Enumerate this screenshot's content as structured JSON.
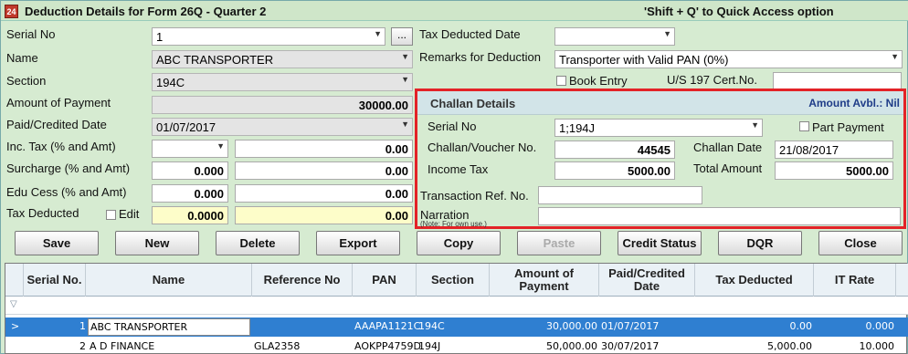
{
  "window": {
    "icon_label": "24",
    "title": "Deduction Details for Form 26Q - Quarter 2",
    "hint": "'Shift + Q' to Quick Access option"
  },
  "left": {
    "serial_no": {
      "label": "Serial No",
      "value": "1",
      "button": "..."
    },
    "name": {
      "label": "Name",
      "value": "ABC TRANSPORTER"
    },
    "section": {
      "label": "Section",
      "value": "194C"
    },
    "amount_of_payment": {
      "label": "Amount of Payment",
      "value": "30000.00"
    },
    "paid_credited_date": {
      "label": "Paid/Credited Date",
      "value": "01/07/2017"
    },
    "inc_tax": {
      "label": "Inc. Tax (% and Amt)",
      "pct": "",
      "amt": "0.00"
    },
    "surcharge": {
      "label": "Surcharge (% and Amt)",
      "pct": "0.000",
      "amt": "0.00"
    },
    "edu_cess": {
      "label": "Edu Cess (% and Amt)",
      "pct": "0.000",
      "amt": "0.00"
    },
    "tax_deducted": {
      "label": "Tax Deducted",
      "edit_label": "Edit",
      "pct": "0.0000",
      "amt": "0.00"
    }
  },
  "right": {
    "tax_deducted_date": {
      "label": "Tax Deducted Date",
      "value": ""
    },
    "remarks": {
      "label": "Remarks for Deduction",
      "value": "Transporter with Valid PAN (0%)"
    },
    "book_entry": {
      "label": "Book Entry"
    },
    "us197": {
      "label": "U/S 197 Cert.No.",
      "value": ""
    }
  },
  "challan": {
    "title": "Challan Details",
    "amount_avbl": "Amount Avbl.: Nil",
    "serial_no": {
      "label": "Serial No",
      "value": "1;194J"
    },
    "part_payment": {
      "label": "Part Payment"
    },
    "voucher": {
      "label": "Challan/Voucher No.",
      "value": "44545"
    },
    "challan_date": {
      "label": "Challan Date",
      "value": "21/08/2017"
    },
    "income_tax": {
      "label": "Income Tax",
      "value": "5000.00"
    },
    "total_amount": {
      "label": "Total Amount",
      "value": "5000.00"
    },
    "transaction_ref": {
      "label": "Transaction Ref. No.",
      "value": ""
    },
    "narration": {
      "label": "Narration",
      "note": "(Note: For own use.)",
      "value": ""
    }
  },
  "buttons": {
    "save": "Save",
    "new": "New",
    "delete": "Delete",
    "export": "Export",
    "copy": "Copy",
    "paste": "Paste",
    "credit_status": "Credit Status",
    "dqr": "DQR",
    "close": "Close"
  },
  "grid": {
    "headers": [
      "Serial No.",
      "Name",
      "Reference No",
      "PAN",
      "Section",
      "Amount of Payment",
      "Paid/Credited Date",
      "Tax Deducted",
      "IT Rate"
    ],
    "rows": [
      {
        "serial": "1",
        "name": "ABC TRANSPORTER",
        "ref": "",
        "pan": "AAAPA1121C",
        "section": "194C",
        "amount": "30,000.00",
        "date": "01/07/2017",
        "tax": "0.00",
        "rate": "0.000"
      },
      {
        "serial": "2",
        "name": "A D FINANCE",
        "ref": "GLA2358",
        "pan": "AOKPP4759D",
        "section": "194J",
        "amount": "50,000.00",
        "date": "30/07/2017",
        "tax": "5,000.00",
        "rate": "10.000"
      }
    ]
  },
  "colors": {
    "accent_highlight": "#e32227",
    "selection": "#2f7fd1",
    "panel": "#d6ebd1"
  }
}
